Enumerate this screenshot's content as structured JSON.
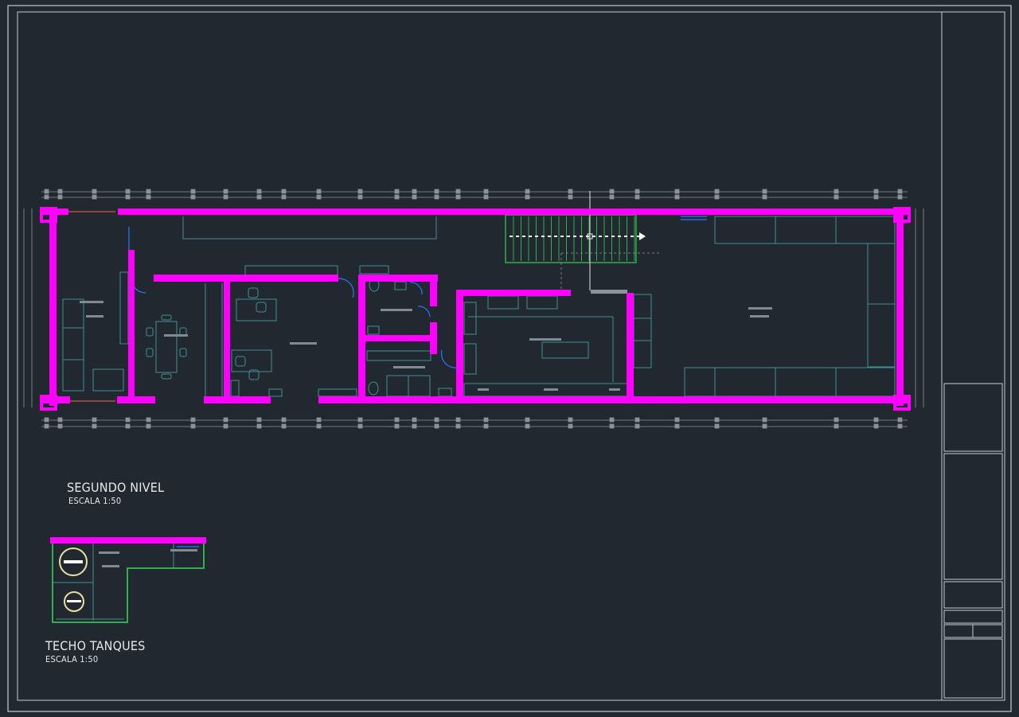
{
  "drawing": {
    "plans": [
      {
        "title": "SEGUNDO NIVEL",
        "scale": "ESCALA 1:50"
      },
      {
        "title": "TECHO TANQUES",
        "scale": "ESCALA 1:50"
      }
    ]
  },
  "colors": {
    "background": "#212830",
    "wall": "#ff00ff",
    "frame": "#c9cdd1",
    "furniture": "#3f8f95",
    "stair": "#2fb04a",
    "door": "#2a78ff",
    "dimension": "#8c9298",
    "label": "#7f8a92"
  },
  "icons": [
    "stair-arrow-icon",
    "tank-icon",
    "door-swing-icon"
  ]
}
